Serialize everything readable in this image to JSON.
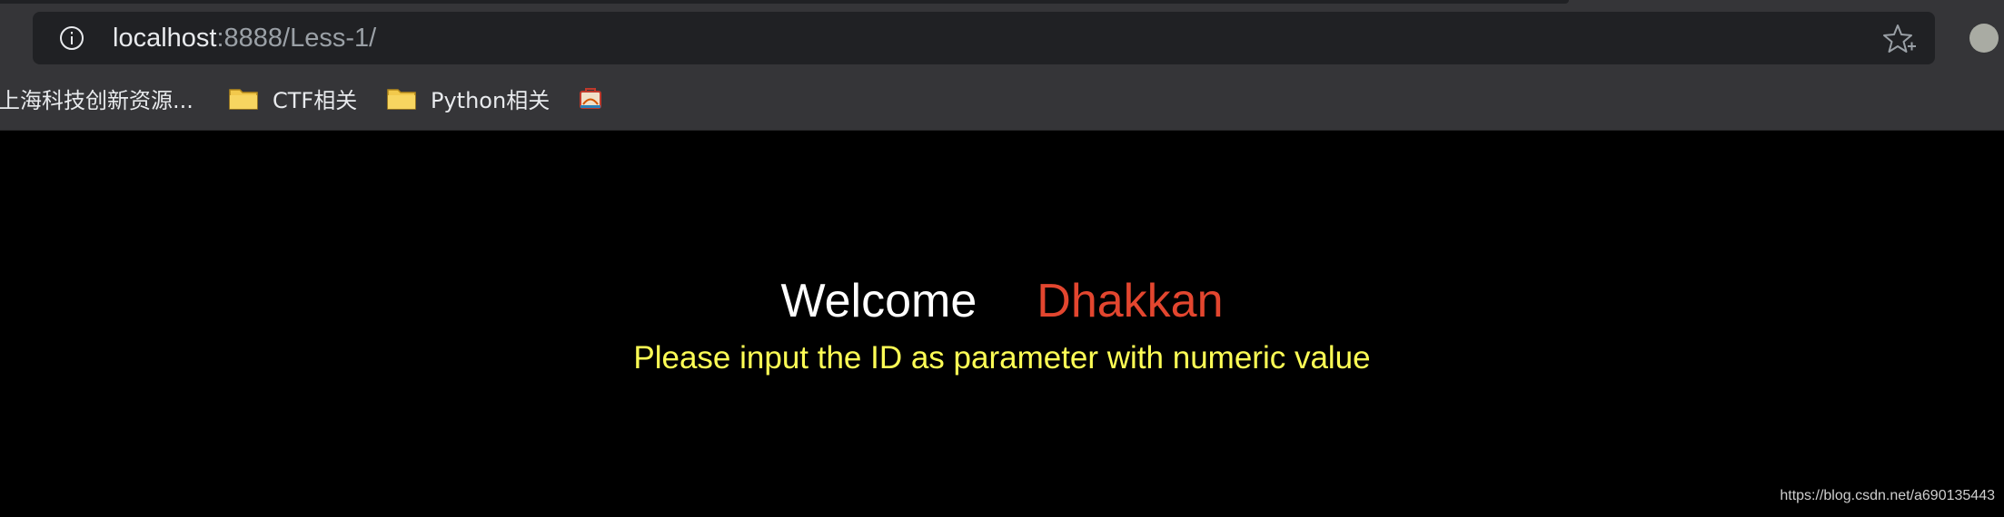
{
  "browser": {
    "url_host": "localhost",
    "url_rest": ":8888/Less-1/",
    "bookmarks": [
      {
        "label": "上海科技创新资源...",
        "icon": "none"
      },
      {
        "label": "CTF相关",
        "icon": "folder-icon"
      },
      {
        "label": "Python相关",
        "icon": "folder-icon"
      },
      {
        "label": "",
        "icon": "bookmark-favicon-icon"
      }
    ]
  },
  "page": {
    "welcome_word": "Welcome",
    "welcome_name": "Dhakkan",
    "instruction": "Please input the ID as parameter with numeric value",
    "watermark": "https://blog.csdn.net/a690135443"
  },
  "colors": {
    "background": "#000000",
    "welcome_word": "#ffffff",
    "welcome_name": "#e3462f",
    "instruction": "#ffff55"
  }
}
